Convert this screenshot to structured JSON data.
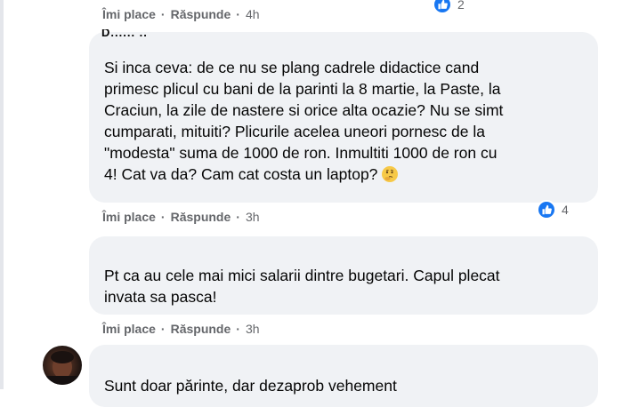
{
  "colors": {
    "bubble_bg": "#f0f2f5",
    "meta_text": "#65676b",
    "like_blue": "#1877f2"
  },
  "comments": [
    {
      "actions": {
        "like": "Îmi place",
        "reply": "Răspunde",
        "time": "4h"
      },
      "reactions": {
        "icon": "like-icon",
        "count": "2"
      }
    },
    {
      "author": "D...... ..",
      "text": "Si inca ceva: de ce nu se plang cadrele didactice cand\nprimesc plicul cu bani de la parinti la 8 martie, la Paste, la\nCraciun, la zile de nastere si orice alta ocazie? Nu se simt\ncumparati, mituiti? Plicurile acelea uneori pornesc de la\n\"modesta\" suma de 1000 de ron. Inmultiti 1000 de ron cu\n4! Cat va da? Cam cat costa un laptop?",
      "emoji": "thinking-face",
      "actions": {
        "like": "Îmi place",
        "reply": "Răspunde",
        "time": "3h"
      },
      "reactions": {
        "icon": "like-icon",
        "count": "4"
      }
    },
    {
      "text": "Pt ca au cele mai mici salarii dintre bugetari. Capul plecat\ninvata sa pasca!",
      "actions": {
        "like": "Îmi place",
        "reply": "Răspunde",
        "time": "3h"
      }
    },
    {
      "text": "Sunt doar părinte, dar dezaprob vehement"
    }
  ]
}
